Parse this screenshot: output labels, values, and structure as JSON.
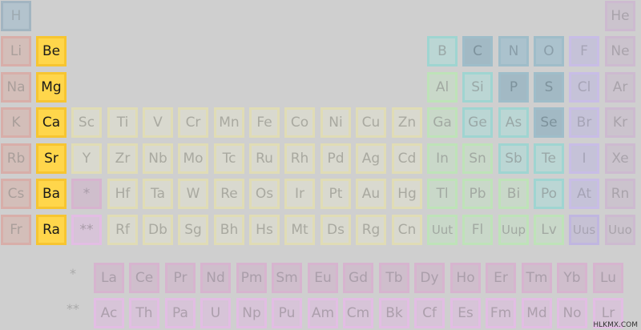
{
  "main_table": [
    {
      "symbol": "H",
      "group": "hyd"
    },
    {
      "symbol": "He",
      "group": "ng"
    },
    {
      "symbol": "Li",
      "group": "alk"
    },
    {
      "symbol": "Be",
      "group": "ae"
    },
    {
      "symbol": "B",
      "group": "met"
    },
    {
      "symbol": "C",
      "group": "rnm",
      "dark": true
    },
    {
      "symbol": "N",
      "group": "rnm"
    },
    {
      "symbol": "O",
      "group": "rnm"
    },
    {
      "symbol": "F",
      "group": "hal"
    },
    {
      "symbol": "Ne",
      "group": "ng"
    },
    {
      "symbol": "Na",
      "group": "alk"
    },
    {
      "symbol": "Mg",
      "group": "ae"
    },
    {
      "symbol": "Al",
      "group": "pt"
    },
    {
      "symbol": "Si",
      "group": "met"
    },
    {
      "symbol": "P",
      "group": "rnm",
      "dark": true
    },
    {
      "symbol": "S",
      "group": "rnm",
      "dark": true
    },
    {
      "symbol": "Cl",
      "group": "hal"
    },
    {
      "symbol": "Ar",
      "group": "ng"
    },
    {
      "symbol": "K",
      "group": "alk"
    },
    {
      "symbol": "Ca",
      "group": "ae"
    },
    {
      "symbol": "Sc",
      "group": "tm"
    },
    {
      "symbol": "Ti",
      "group": "tm"
    },
    {
      "symbol": "V",
      "group": "tm"
    },
    {
      "symbol": "Cr",
      "group": "tm"
    },
    {
      "symbol": "Mn",
      "group": "tm"
    },
    {
      "symbol": "Fe",
      "group": "tm"
    },
    {
      "symbol": "Co",
      "group": "tm"
    },
    {
      "symbol": "Ni",
      "group": "tm"
    },
    {
      "symbol": "Cu",
      "group": "tm"
    },
    {
      "symbol": "Zn",
      "group": "tm"
    },
    {
      "symbol": "Ga",
      "group": "pt"
    },
    {
      "symbol": "Ge",
      "group": "met"
    },
    {
      "symbol": "As",
      "group": "met"
    },
    {
      "symbol": "Se",
      "group": "rnm",
      "dark": true
    },
    {
      "symbol": "Br",
      "group": "hal"
    },
    {
      "symbol": "Kr",
      "group": "ng"
    },
    {
      "symbol": "Rb",
      "group": "alk"
    },
    {
      "symbol": "Sr",
      "group": "ae"
    },
    {
      "symbol": "Y",
      "group": "tm"
    },
    {
      "symbol": "Zr",
      "group": "tm"
    },
    {
      "symbol": "Nb",
      "group": "tm"
    },
    {
      "symbol": "Mo",
      "group": "tm"
    },
    {
      "symbol": "Tc",
      "group": "tm"
    },
    {
      "symbol": "Ru",
      "group": "tm"
    },
    {
      "symbol": "Rh",
      "group": "tm"
    },
    {
      "symbol": "Pd",
      "group": "tm"
    },
    {
      "symbol": "Ag",
      "group": "tm"
    },
    {
      "symbol": "Cd",
      "group": "tm"
    },
    {
      "symbol": "In",
      "group": "pt"
    },
    {
      "symbol": "Sn",
      "group": "pt"
    },
    {
      "symbol": "Sb",
      "group": "met"
    },
    {
      "symbol": "Te",
      "group": "met"
    },
    {
      "symbol": "I",
      "group": "hal"
    },
    {
      "symbol": "Xe",
      "group": "ng"
    },
    {
      "symbol": "Cs",
      "group": "alk"
    },
    {
      "symbol": "Ba",
      "group": "ae"
    },
    {
      "symbol": "*",
      "group": "lp"
    },
    {
      "symbol": "Hf",
      "group": "tm"
    },
    {
      "symbol": "Ta",
      "group": "tm"
    },
    {
      "symbol": "W",
      "group": "tm"
    },
    {
      "symbol": "Re",
      "group": "tm"
    },
    {
      "symbol": "Os",
      "group": "tm"
    },
    {
      "symbol": "Ir",
      "group": "tm"
    },
    {
      "symbol": "Pt",
      "group": "tm"
    },
    {
      "symbol": "Au",
      "group": "tm"
    },
    {
      "symbol": "Hg",
      "group": "tm"
    },
    {
      "symbol": "Tl",
      "group": "pt"
    },
    {
      "symbol": "Pb",
      "group": "pt"
    },
    {
      "symbol": "Bi",
      "group": "pt"
    },
    {
      "symbol": "Po",
      "group": "met"
    },
    {
      "symbol": "At",
      "group": "hal"
    },
    {
      "symbol": "Rn",
      "group": "ng"
    },
    {
      "symbol": "Fr",
      "group": "alk"
    },
    {
      "symbol": "Ra",
      "group": "ae"
    },
    {
      "symbol": "**",
      "group": "ap"
    },
    {
      "symbol": "Rf",
      "group": "tm"
    },
    {
      "symbol": "Db",
      "group": "tm"
    },
    {
      "symbol": "Sg",
      "group": "tm"
    },
    {
      "symbol": "Bh",
      "group": "tm"
    },
    {
      "symbol": "Hs",
      "group": "tm"
    },
    {
      "symbol": "Mt",
      "group": "tm"
    },
    {
      "symbol": "Ds",
      "group": "tm"
    },
    {
      "symbol": "Rg",
      "group": "tm"
    },
    {
      "symbol": "Cn",
      "group": "tm"
    },
    {
      "symbol": "Uut",
      "group": "pt",
      "small": true
    },
    {
      "symbol": "Fl",
      "group": "pt"
    },
    {
      "symbol": "Uup",
      "group": "pt",
      "small": true
    },
    {
      "symbol": "Lv",
      "group": "pt"
    },
    {
      "symbol": "Uus",
      "group": "unk",
      "small": true
    },
    {
      "symbol": "Uuo",
      "group": "ng",
      "small": true
    }
  ],
  "lanthanide_label": "*",
  "actinide_label": "**",
  "lanthanides": [
    "La",
    "Ce",
    "Pr",
    "Nd",
    "Pm",
    "Sm",
    "Eu",
    "Gd",
    "Tb",
    "Dy",
    "Ho",
    "Er",
    "Tm",
    "Yb",
    "Lu"
  ],
  "actinides": [
    "Ac",
    "Th",
    "Pa",
    "U",
    "Np",
    "Pu",
    "Am",
    "Cm",
    "Bk",
    "Cf",
    "Es",
    "Fm",
    "Md",
    "No",
    "Lr"
  ],
  "watermark": "HLKMX.COM",
  "colors": {
    "background": "#cfcfcf",
    "alkaline_earth_highlight": "#ffd64b"
  }
}
